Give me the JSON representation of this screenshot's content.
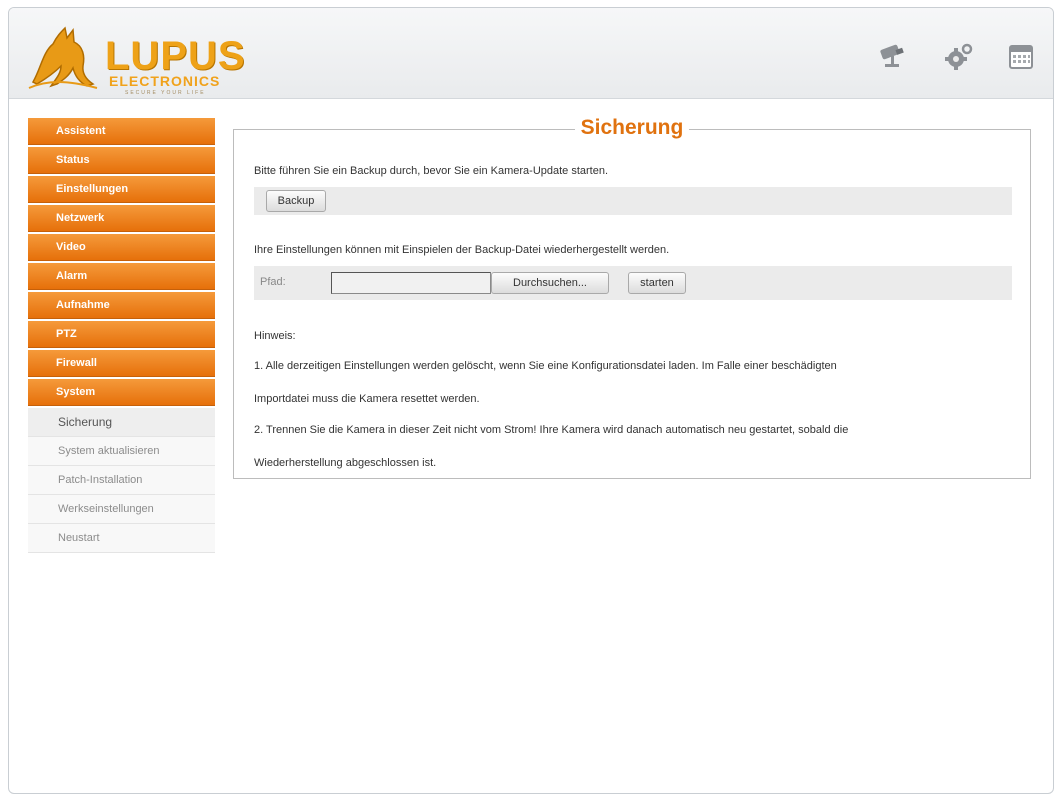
{
  "brand": {
    "name": "LUPUS",
    "sub": "ELECTRONICS",
    "tagline": "SECURE YOUR LIFE",
    "accent": "#e0720f"
  },
  "header_icons": [
    "camera-icon",
    "gear-icon",
    "calendar-icon"
  ],
  "sidebar": {
    "items": [
      {
        "label": "Assistent"
      },
      {
        "label": "Status"
      },
      {
        "label": "Einstellungen"
      },
      {
        "label": "Netzwerk"
      },
      {
        "label": "Video"
      },
      {
        "label": "Alarm"
      },
      {
        "label": "Aufnahme"
      },
      {
        "label": "PTZ"
      },
      {
        "label": "Firewall"
      },
      {
        "label": "System"
      }
    ],
    "subitems": [
      {
        "label": "Sicherung",
        "active": true
      },
      {
        "label": "System aktualisieren"
      },
      {
        "label": "Patch-Installation"
      },
      {
        "label": "Werkseinstellungen"
      },
      {
        "label": "Neustart"
      }
    ]
  },
  "panel": {
    "title": "Sicherung",
    "backup_text": "Bitte führen Sie ein Backup durch, bevor Sie ein Kamera-Update starten.",
    "backup_button": "Backup",
    "restore_text": "Ihre Einstellungen können mit Einspielen der Backup-Datei wiederhergestellt werden.",
    "path_label": "Pfad:",
    "browse_button": "Durchsuchen...",
    "start_button": "starten",
    "note_heading": "Hinweis:",
    "note1_line1": "1. Alle derzeitigen Einstellungen werden gelöscht, wenn Sie eine Konfigurationsdatei laden. Im Falle einer beschädigten",
    "note1_line2": "Importdatei muss die Kamera resettet werden.",
    "note2_line1": "2. Trennen Sie die Kamera in dieser Zeit nicht vom Strom! Ihre Kamera wird danach automatisch neu gestartet, sobald die",
    "note2_line2": "Wiederherstellung abgeschlossen ist."
  }
}
